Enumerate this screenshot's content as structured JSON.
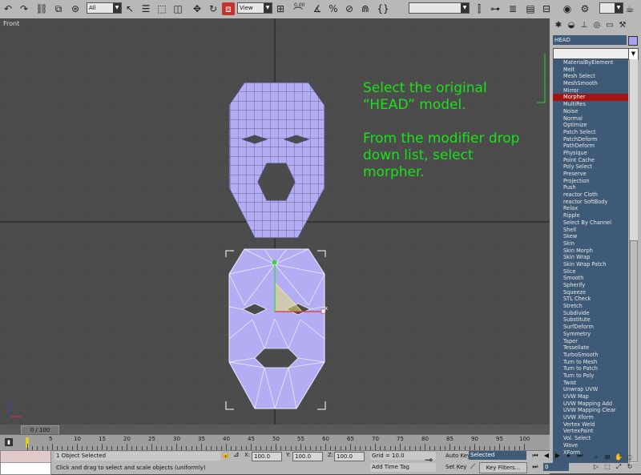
{
  "toolbar": {
    "filter_select": "All",
    "coord_select": "View",
    "snap_value": "0.00",
    "named_sel_select": ""
  },
  "viewport": {
    "label": "Front",
    "instruction_lines": [
      "Select the original",
      "“HEAD” model.",
      "",
      "From the modifier drop",
      "down list, select",
      "morpher."
    ],
    "gizmo_axis_label": "x"
  },
  "modify_panel": {
    "object_name": "HEAD",
    "object_color": "#a8a0f0",
    "modifier_list": [
      "MaterialByElement",
      "Melt",
      "Mesh Select",
      "MeshSmooth",
      "Mirror",
      "Morpher",
      "MultiRes",
      "Noise",
      "Normal",
      "Optimize",
      "Patch Select",
      "PatchDeform",
      "PathDeform",
      "Physique",
      "Point Cache",
      "Poly Select",
      "Preserve",
      "Projection",
      "Push",
      "reactor Cloth",
      "reactor SoftBody",
      "Relax",
      "Ripple",
      "Select By Channel",
      "Shell",
      "Skew",
      "Skin",
      "Skin Morph",
      "Skin Wrap",
      "Skin Wrap Patch",
      "Slice",
      "Smooth",
      "Spherify",
      "Squeeze",
      "STL Check",
      "Stretch",
      "Subdivide",
      "Substitute",
      "SurfDeform",
      "Symmetry",
      "Taper",
      "Tessellate",
      "TurboSmooth",
      "Turn to Mesh",
      "Turn to Patch",
      "Turn to Poly",
      "Twist",
      "Unwrap UVW",
      "UVW Map",
      "UVW Mapping Add",
      "UVW Mapping Clear",
      "UVW Xform",
      "Vertex Weld",
      "VertexPaint",
      "Vol. Select",
      "Wave",
      "XForm"
    ],
    "selected_modifier": "Morpher",
    "selection_color": "#a31515"
  },
  "timeline": {
    "slider_label": "0 / 100",
    "ticks": [
      "5",
      "10",
      "15",
      "20",
      "25",
      "30",
      "35",
      "40",
      "45",
      "50",
      "55",
      "60",
      "65",
      "70",
      "75",
      "80",
      "85",
      "90",
      "95",
      "100"
    ]
  },
  "status": {
    "selection_text": "1 Object Selected",
    "prompt_text": "Click and drag to select and scale objects (uniformly)",
    "x_label": "X:",
    "x_value": "100.0",
    "y_label": "Y:",
    "y_value": "100.0",
    "z_label": "Z:",
    "z_value": "100.0",
    "grid_text": "Grid = 10.0",
    "add_time_tag": "Add Time Tag",
    "auto_key": "Auto Key",
    "set_key": "Set Key",
    "selected_dropdown": "Selected",
    "key_filters": "Key Filters...",
    "frame_value": "0"
  },
  "colors": {
    "mesh_fill": "#b3aef4",
    "instruction_text": "#19e219",
    "viewport_bg": "#4b4b4b"
  }
}
